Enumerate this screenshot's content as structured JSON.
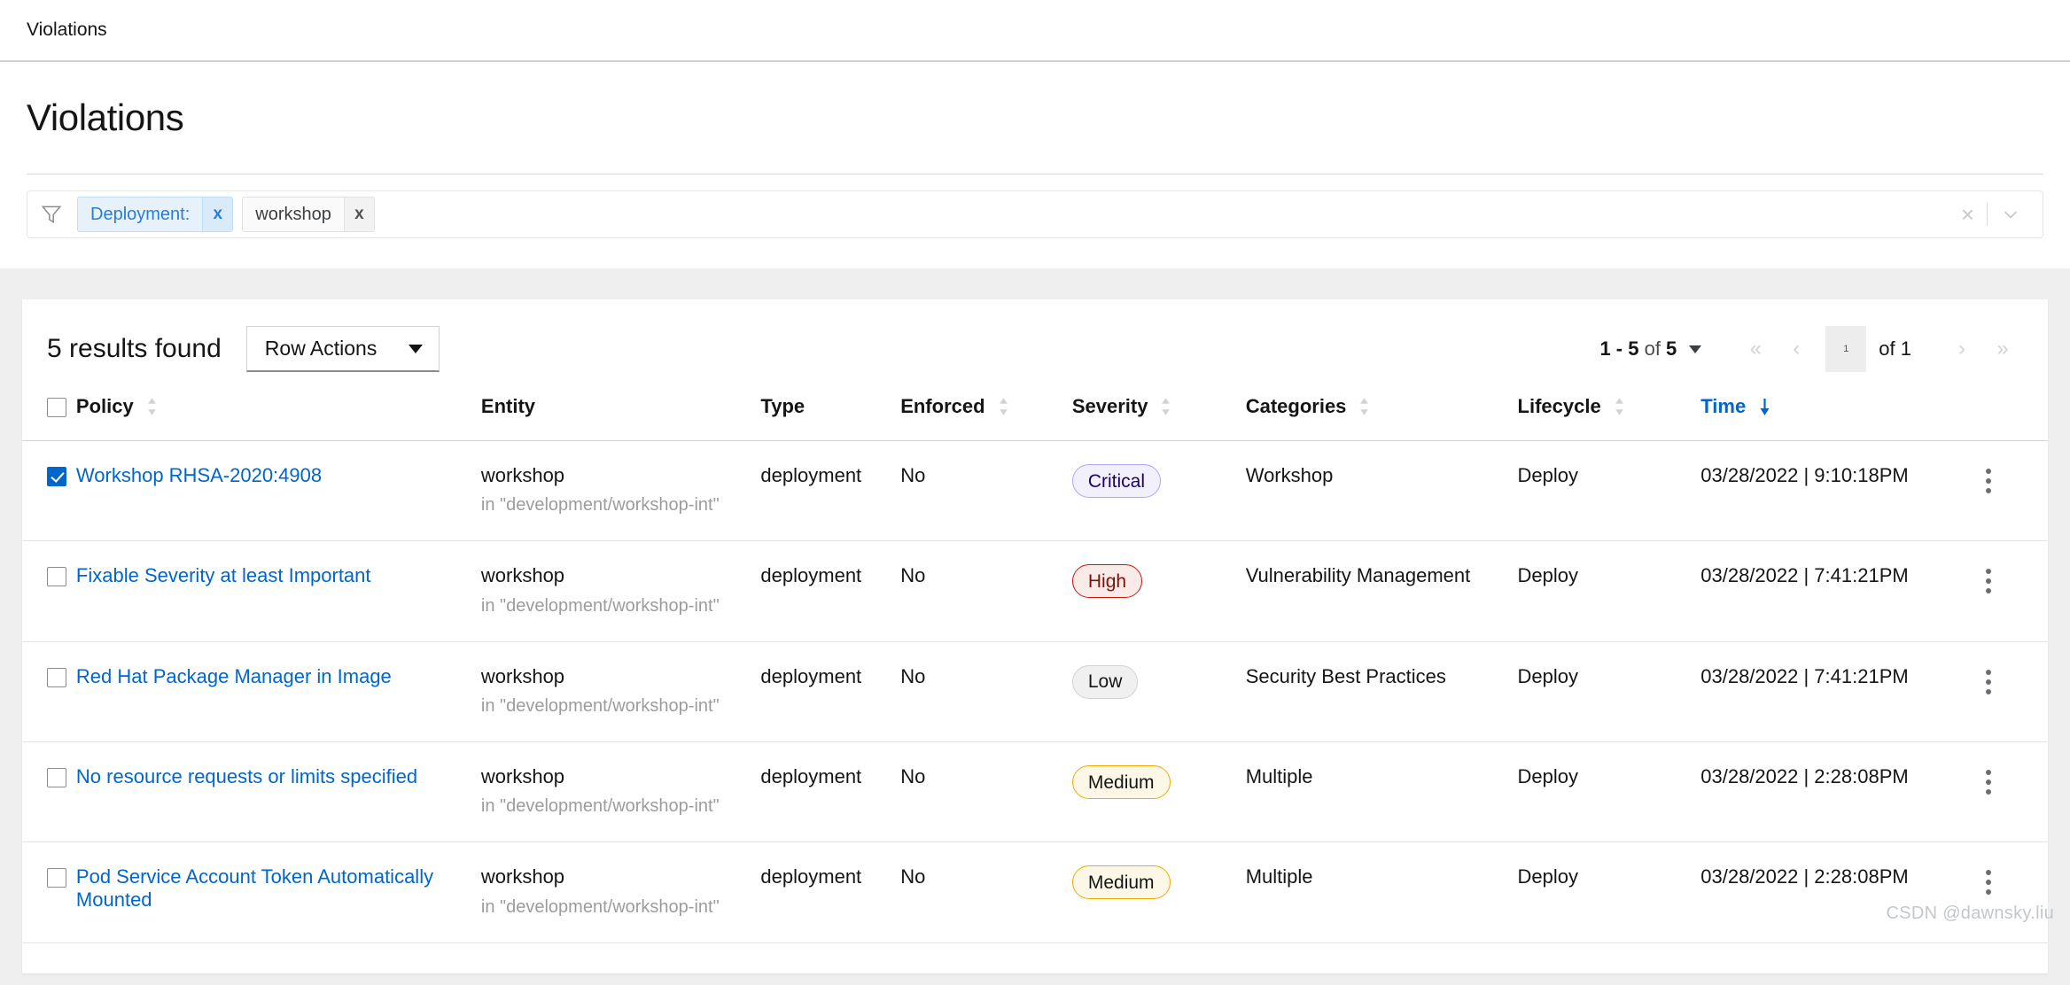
{
  "breadcrumb": {
    "label": "Violations"
  },
  "header": {
    "title": "Violations"
  },
  "filter_bar": {
    "funnel_icon": "funnel-icon",
    "chips": [
      {
        "label": "Deployment:",
        "remove": "x",
        "style": "blue"
      },
      {
        "label": "workshop",
        "remove": "x",
        "style": "grey"
      }
    ],
    "clear_all": "×",
    "expand_icon": "chevron-down-icon"
  },
  "toolbar": {
    "results_found": "5 results found",
    "row_actions_label": "Row Actions"
  },
  "pagination": {
    "range_prefix": "1 - 5",
    "range_of": " of ",
    "range_total": "5",
    "page_value": "1",
    "of_pages": "of 1",
    "first_icon": "«",
    "prev_icon": "‹",
    "next_icon": "›",
    "last_icon": "»"
  },
  "table": {
    "columns": [
      {
        "label": "Policy",
        "sortable": true,
        "sorted": "none"
      },
      {
        "label": "Entity",
        "sortable": false,
        "sorted": "none"
      },
      {
        "label": "Type",
        "sortable": false,
        "sorted": "none"
      },
      {
        "label": "Enforced",
        "sortable": true,
        "sorted": "none"
      },
      {
        "label": "Severity",
        "sortable": true,
        "sorted": "none"
      },
      {
        "label": "Categories",
        "sortable": true,
        "sorted": "none"
      },
      {
        "label": "Lifecycle",
        "sortable": true,
        "sorted": "none"
      },
      {
        "label": "Time",
        "sortable": true,
        "sorted": "desc"
      }
    ],
    "rows": [
      {
        "selected": true,
        "policy": "Workshop RHSA-2020:4908",
        "entity": "workshop",
        "entity_sub": "in \"development/workshop-int\"",
        "type": "deployment",
        "enforced": "No",
        "severity": "Critical",
        "severity_level": "critical",
        "categories": "Workshop",
        "lifecycle": "Deploy",
        "time": "03/28/2022 | 9:10:18PM"
      },
      {
        "selected": false,
        "policy": "Fixable Severity at least Important",
        "entity": "workshop",
        "entity_sub": "in \"development/workshop-int\"",
        "type": "deployment",
        "enforced": "No",
        "severity": "High",
        "severity_level": "high",
        "categories": "Vulnerability Management",
        "lifecycle": "Deploy",
        "time": "03/28/2022 | 7:41:21PM"
      },
      {
        "selected": false,
        "policy": "Red Hat Package Manager in Image",
        "entity": "workshop",
        "entity_sub": "in \"development/workshop-int\"",
        "type": "deployment",
        "enforced": "No",
        "severity": "Low",
        "severity_level": "low",
        "categories": "Security Best Practices",
        "lifecycle": "Deploy",
        "time": "03/28/2022 | 7:41:21PM"
      },
      {
        "selected": false,
        "policy": "No resource requests or limits specified",
        "entity": "workshop",
        "entity_sub": "in \"development/workshop-int\"",
        "type": "deployment",
        "enforced": "No",
        "severity": "Medium",
        "severity_level": "medium",
        "categories": "Multiple",
        "lifecycle": "Deploy",
        "time": "03/28/2022 | 2:28:08PM"
      },
      {
        "selected": false,
        "policy": "Pod Service Account Token Automatically Mounted",
        "entity": "workshop",
        "entity_sub": "in \"development/workshop-int\"",
        "type": "deployment",
        "enforced": "No",
        "severity": "Medium",
        "severity_level": "medium",
        "categories": "Multiple",
        "lifecycle": "Deploy",
        "time": "03/28/2022 | 2:28:08PM"
      }
    ]
  },
  "watermark": {
    "text": "CSDN @dawnsky.liu"
  },
  "colors": {
    "link": "#0066cc",
    "chip_blue_text": "#2b7cd3",
    "chip_blue_bg": "#e7f1fa",
    "critical": "#b2a3ff",
    "high": "#c9190b",
    "medium": "#f0ab00",
    "low": "#d2d2d2",
    "page_bg": "#efeff0"
  }
}
